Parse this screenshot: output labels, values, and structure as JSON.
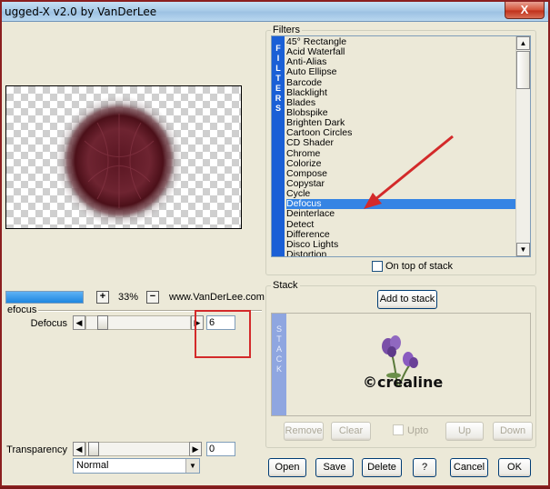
{
  "window": {
    "title": "ugged-X v2.0 by VanDerLee",
    "close_glyph": "X"
  },
  "preview": {
    "zoom_level": "33%",
    "zoom_in": "+",
    "zoom_out": "−",
    "website": "www.VanDerLee.com"
  },
  "parameters": {
    "section_label": "efocus",
    "defocus_label": "Defocus",
    "defocus_value": "6",
    "transparency_label": "Transparency",
    "transparency_value": "0",
    "blend_mode": "Normal"
  },
  "filters": {
    "group_label": "Filters",
    "strip_letters": [
      "F",
      "I",
      "L",
      "T",
      "E",
      "R",
      "S"
    ],
    "items": [
      "45° Rectangle",
      "Acid Waterfall",
      "Anti-Alias",
      "Auto Ellipse",
      "Barcode",
      "Blacklight",
      "Blades",
      "Blobspike",
      "Brighten Dark",
      "Cartoon Circles",
      "CD Shader",
      "Chrome",
      "Colorize",
      "Compose",
      "Copystar",
      "Cycle",
      "Defocus",
      "Deinterlace",
      "Detect",
      "Difference",
      "Disco Lights",
      "Distortion"
    ],
    "selected": "Defocus",
    "on_top_label": "On top of stack"
  },
  "stack": {
    "group_label": "Stack",
    "add_button": "Add to stack",
    "strip_letters": [
      "S",
      "T",
      "A",
      "C",
      "K"
    ],
    "logo_text": "©crealine",
    "remove_button": "Remove",
    "clear_button": "Clear",
    "upto_label": "Upto",
    "up_button": "Up",
    "down_button": "Down"
  },
  "bottom_buttons": {
    "open": "Open",
    "save": "Save",
    "delete": "Delete",
    "help": "?",
    "cancel": "Cancel",
    "ok": "OK"
  },
  "icons": {
    "arrow_left": "◀",
    "arrow_right": "▶",
    "arrow_up": "▲",
    "arrow_down": "▼"
  },
  "colors": {
    "selection": "#3584e4",
    "filter_strip": "#1a5fd6",
    "annotation_red": "#d32a2a"
  }
}
